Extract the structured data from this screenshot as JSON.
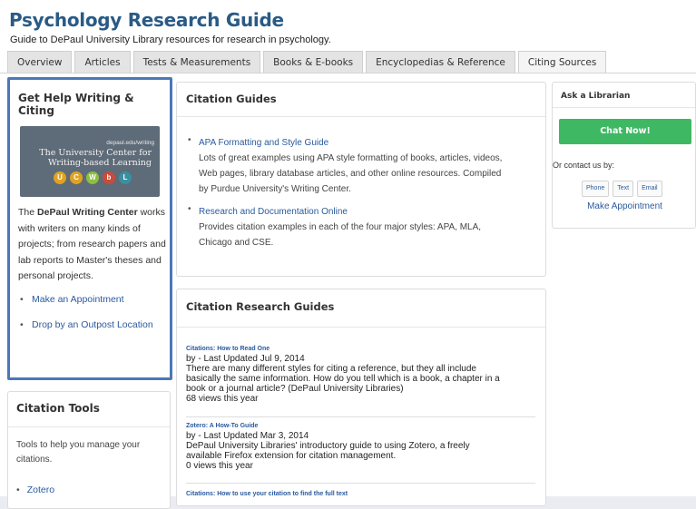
{
  "header": {
    "title": "Psychology Research Guide",
    "subtitle": "Guide to DePaul University Library resources for research in psychology."
  },
  "tabs": [
    {
      "label": "Overview"
    },
    {
      "label": "Articles"
    },
    {
      "label": "Tests & Measurements"
    },
    {
      "label": "Books & E-books"
    },
    {
      "label": "Encyclopedias & Reference"
    },
    {
      "label": "Citing Sources",
      "active": true
    }
  ],
  "help_box": {
    "heading": "Get Help Writing & Citing",
    "banner": {
      "url": "depaul.edu/writing",
      "line1": "The University Center for",
      "line2": "Writing-based Learning",
      "letters": [
        "U",
        "C",
        "W",
        "b",
        "L"
      ],
      "letter_colors": [
        "#e0a21f",
        "#e0a21f",
        "#8dbf3f",
        "#c94b3a",
        "#3a8fa0"
      ]
    },
    "desc_before": "The ",
    "desc_bold": "DePaul Writing Center",
    "desc_after": " works with writers on many kinds of projects; from research papers and lab reports to Master's theses and personal projects.",
    "links": [
      "Make an Appointment",
      "Drop by an Outpost Location"
    ]
  },
  "citation_tools": {
    "heading": "Citation Tools",
    "desc": "Tools to help you manage your citations.",
    "items": [
      "Zotero"
    ]
  },
  "citation_guides": {
    "heading": "Citation Guides",
    "items": [
      {
        "link": "APA Formatting and Style Guide",
        "lines": [
          "Lots of great examples using APA style formatting of books, articles, videos,",
          "Web pages, library database articles, and other online resources. Compiled",
          "by Purdue University's Writing Center."
        ]
      },
      {
        "link": "Research and Documentation Online",
        "lines": [
          "Provides citation examples in each of the four major styles: APA, MLA,",
          "Chicago and CSE."
        ]
      }
    ]
  },
  "citation_research": {
    "heading": "Citation Research Guides",
    "entries": [
      {
        "title": "Citations: How to Read One",
        "updated": "by - Last Updated Jul 9, 2014",
        "lines": [
          "There are many different styles for citing a reference, but they all include",
          "basically the same information. How do you tell which is a book, a chapter in a",
          "book or a journal article? (DePaul University Libraries)"
        ],
        "views": "68 views this year"
      },
      {
        "title": "Zotero: A How-To Guide",
        "updated": "by - Last Updated Mar 3, 2014",
        "lines": [
          "DePaul University Libraries' introductory guide to using Zotero, a freely",
          "available Firefox extension for citation management."
        ],
        "views": "0 views this year"
      },
      {
        "title": "Citations: How to use your citation to find the full text"
      }
    ]
  },
  "ask": {
    "heading": "Ask a Librarian",
    "chat_label": "Chat Now!",
    "contact_label": "Or contact us by:",
    "buttons": [
      "Phone",
      "Text",
      "Email"
    ],
    "appointment": "Make Appointment"
  },
  "colors": {
    "title": "#2a5a86",
    "link": "#2a5a9e",
    "highlight_border": "#4a78b8",
    "chat_button": "#3fb863"
  }
}
